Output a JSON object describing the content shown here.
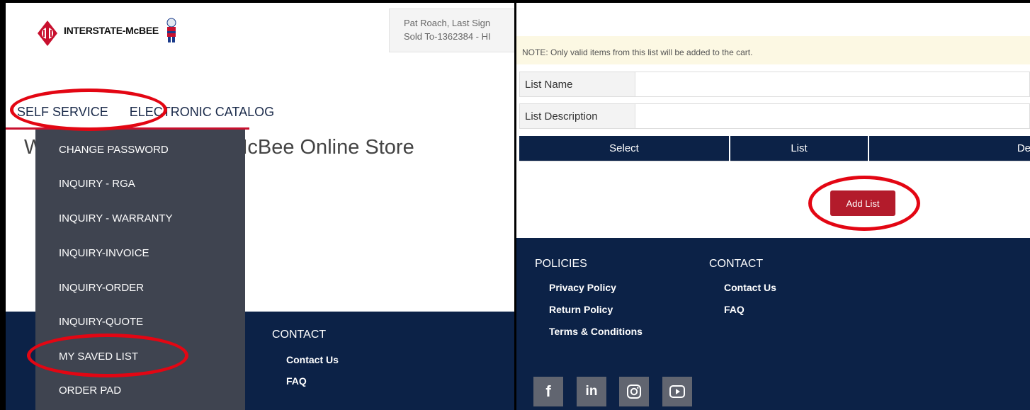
{
  "left_panel": {
    "logo_text": "INTERSTATE-McBEE",
    "user_info": {
      "line1": "Pat Roach, Last Sign",
      "line2": "Sold To-1362384 - HI"
    },
    "nav": {
      "self_service": "SELF SERVICE",
      "electronic_catalog": "ELECTRONIC CATALOG"
    },
    "welcome_text": "Welcome to Interstate-McBee Online Store",
    "dropdown_items": [
      "CHANGE PASSWORD",
      "INQUIRY - RGA",
      "INQUIRY - WARRANTY",
      "INQUIRY-INVOICE",
      "INQUIRY-ORDER",
      "INQUIRY-QUOTE",
      "MY SAVED LIST",
      "ORDER PAD"
    ],
    "footer": {
      "contact_heading": "CONTACT",
      "contact_us": "Contact Us",
      "faq": "FAQ"
    }
  },
  "right_panel": {
    "note": "NOTE: Only valid items from this list will be added to the cart.",
    "form": {
      "list_name_label": "List Name",
      "list_name_value": "",
      "list_description_label": "List Description",
      "list_description_value": ""
    },
    "table_headers": [
      "Select",
      "List",
      "De"
    ],
    "add_list_button": "Add List",
    "footer": {
      "policies_heading": "POLICIES",
      "privacy_policy": "Privacy Policy",
      "return_policy": "Return Policy",
      "terms": "Terms & Conditions",
      "contact_heading": "CONTACT",
      "contact_us": "Contact Us",
      "faq": "FAQ"
    },
    "social_icons": [
      "facebook-icon",
      "linkedin-icon",
      "instagram-icon",
      "youtube-icon"
    ]
  },
  "colors": {
    "navy": "#0c2247",
    "red_highlight": "#e30613",
    "button_red": "#b31b2b",
    "dropdown_bg": "#3f4450",
    "note_bg": "#fcf8e3"
  }
}
